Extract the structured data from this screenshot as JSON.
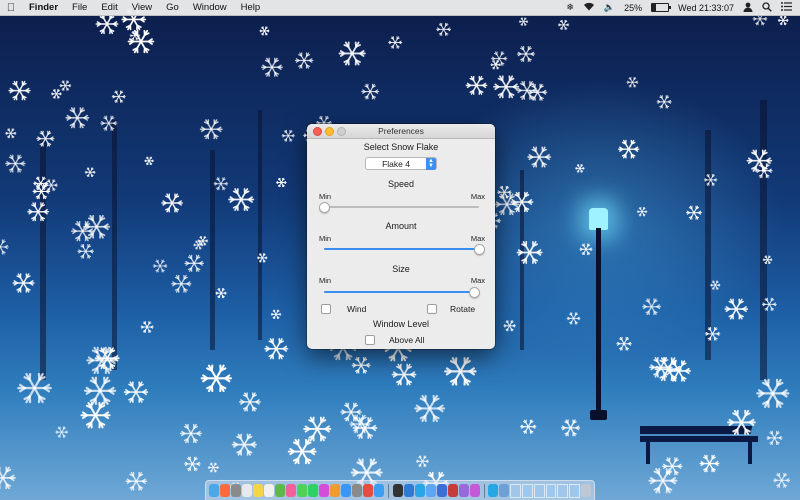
{
  "menubar": {
    "apple": "",
    "app_name": "Finder",
    "items": [
      "File",
      "Edit",
      "View",
      "Go",
      "Window",
      "Help"
    ],
    "battery_percent": "25%",
    "clock": "Wed 21:33:07"
  },
  "window": {
    "title": "Preferences",
    "select_label": "Select Snow Flake",
    "flake_selected": "Flake 4",
    "speed": {
      "label": "Speed",
      "min_label": "Min",
      "max_label": "Max",
      "value": 0.0
    },
    "amount": {
      "label": "Amount",
      "min_label": "Min",
      "max_label": "Max",
      "value": 1.0
    },
    "size": {
      "label": "Size",
      "min_label": "Min",
      "max_label": "Max",
      "value": 0.97
    },
    "wind": {
      "label": "Wind",
      "checked": false
    },
    "rotate": {
      "label": "Rotate",
      "checked": false
    },
    "window_level_label": "Window Level",
    "above_all": {
      "label": "Above All",
      "checked": false
    }
  },
  "dock": {
    "icons": [
      "finder-icon",
      "launchpad-icon",
      "photo-icon",
      "calendar-icon",
      "notes-icon",
      "reminders-icon",
      "maps-icon",
      "photos-icon",
      "messages-icon",
      "facetime-icon",
      "itunes-icon",
      "ibooks-icon",
      "appstore-icon",
      "preferences-icon",
      "chrome-icon",
      "safari-icon",
      "terminal-icon",
      "xcode-icon",
      "skype-icon",
      "mail-icon",
      "keynote-icon",
      "photo-booth-icon",
      "game-center-icon",
      "flower-icon",
      "skype-2-icon",
      "downloads-icon"
    ],
    "icon_colors": [
      "#4aa7ea",
      "#ff6a3c",
      "#8a8a8a",
      "#e9e9e9",
      "#f5d44a",
      "#f0f0f0",
      "#5fb84a",
      "#f25f9a",
      "#4fd15a",
      "#2fd065",
      "#d44dd8",
      "#f29a2e",
      "#3b95f2",
      "#8a8a8a",
      "#e94b3c",
      "#3c9ef0",
      "#333333",
      "#2e7bd6",
      "#2aa6e8",
      "#5da7f2",
      "#3b6ed6",
      "#c43c3c",
      "#9a68d8",
      "#c45ad8",
      "#23a8e3",
      "#6ea0d8"
    ]
  },
  "colors": {
    "accent": "#3b8ff3",
    "close": "#fc5f57",
    "minimize": "#fdbc2e"
  }
}
